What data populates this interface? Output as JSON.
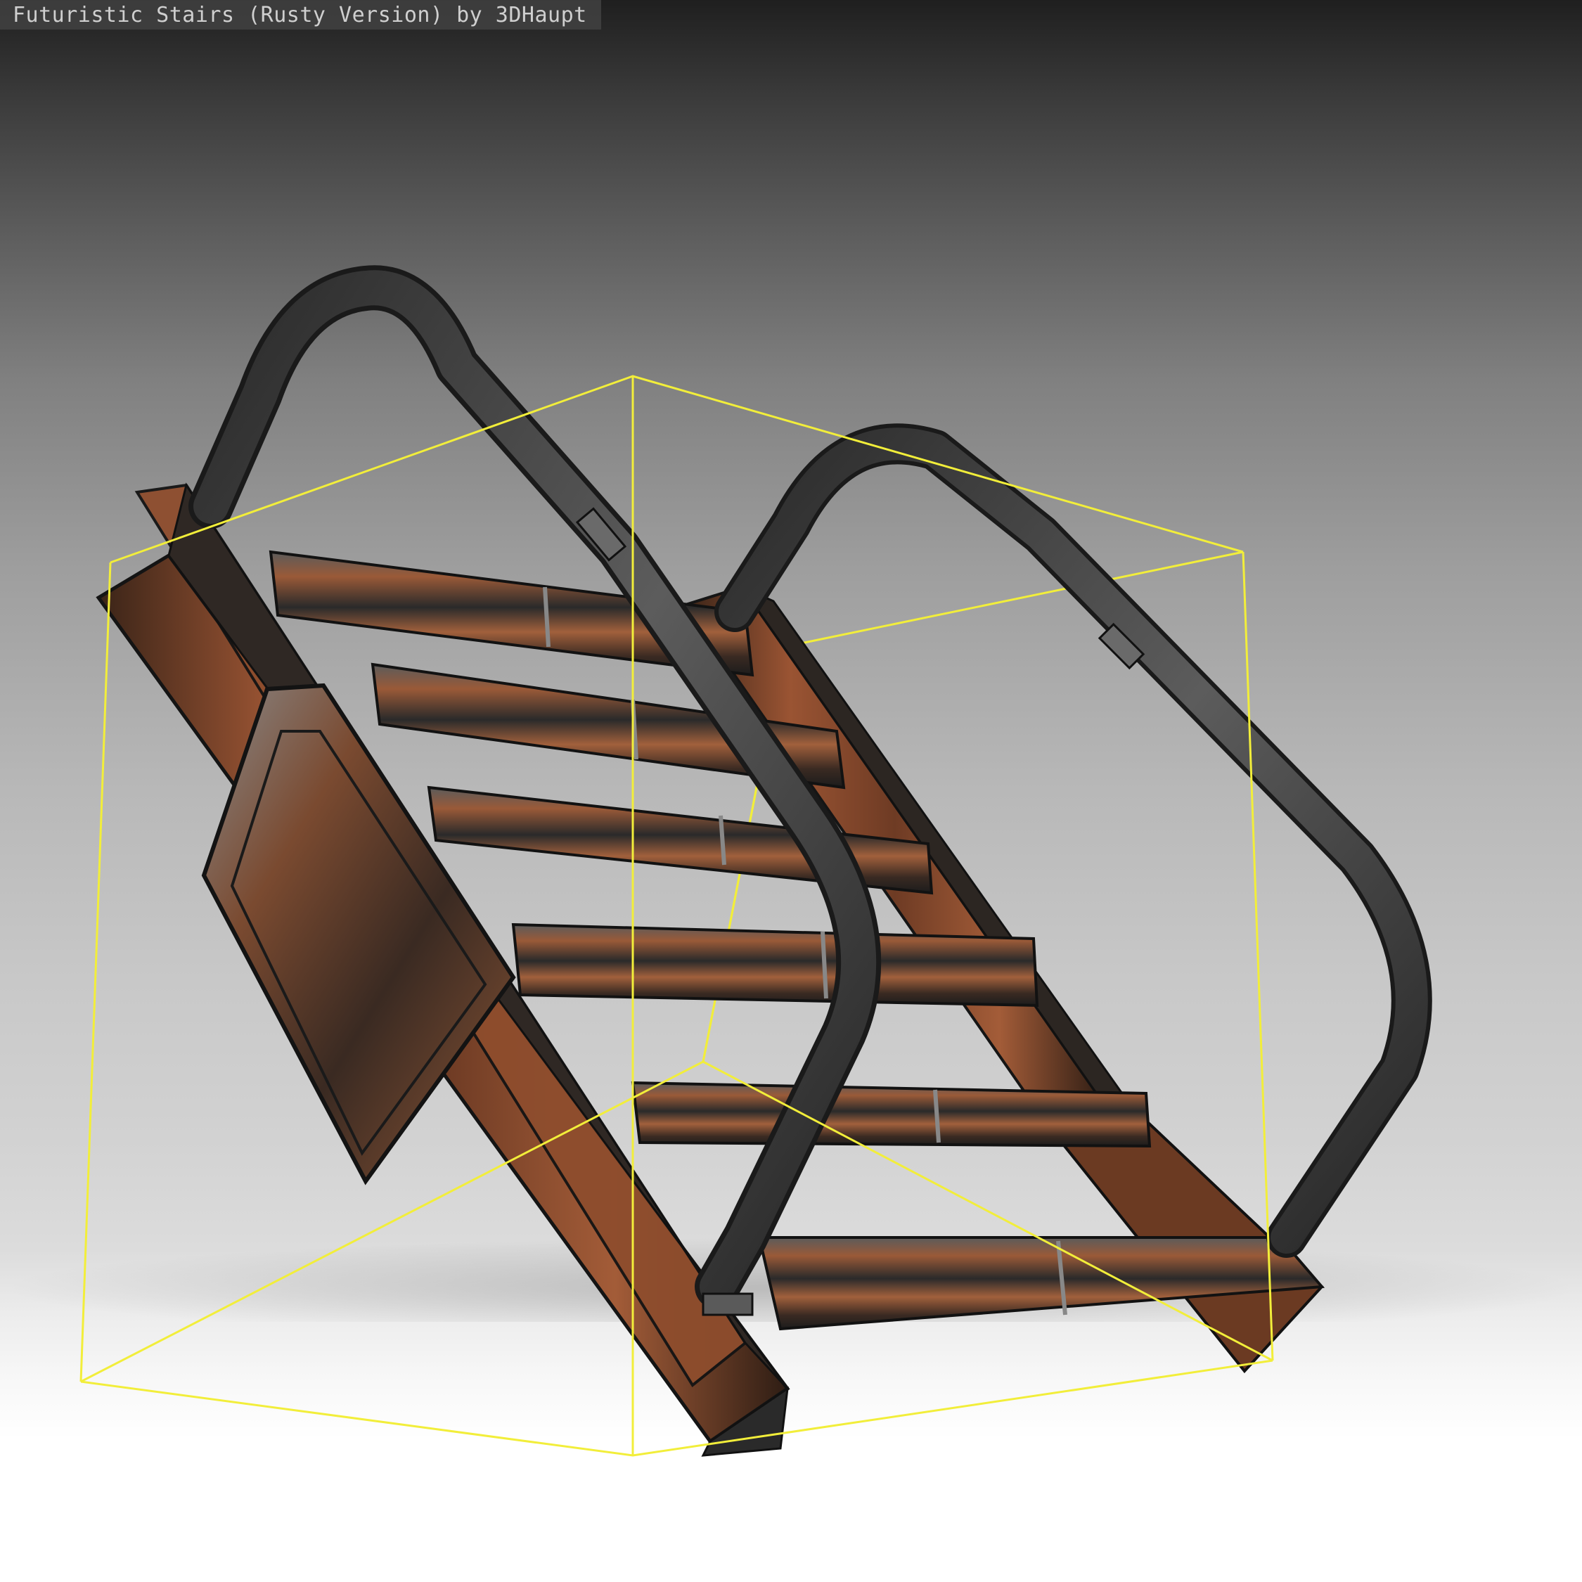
{
  "viewer": {
    "title": "Futuristic Stairs (Rusty Version) by 3DHaupt",
    "model_icon": "stairs-model",
    "bounding_box_color": "#f2ee3a",
    "rust_color": "#8a4a2c",
    "metal_color": "#3b3b3b"
  }
}
